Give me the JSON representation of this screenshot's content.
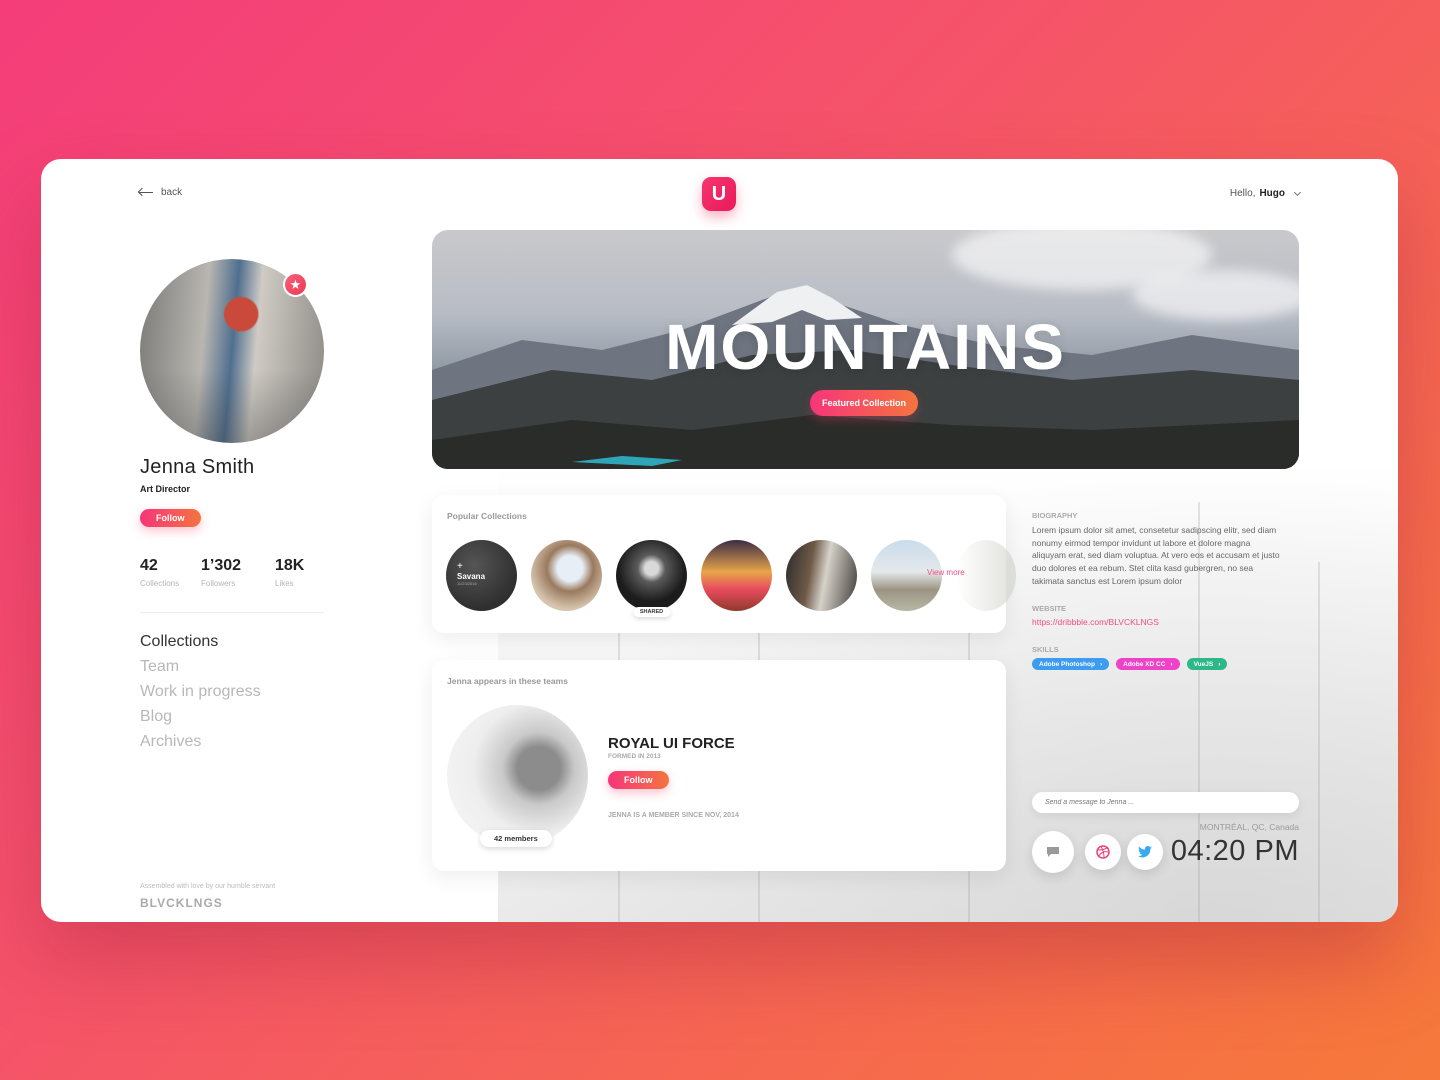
{
  "header": {
    "back_label": "back",
    "logo_text": "U",
    "greeting": "Hello,",
    "user": "Hugo"
  },
  "profile": {
    "name": "Jenna Smith",
    "role": "Art Director",
    "follow_label": "Follow",
    "stats": [
      {
        "value": "42",
        "label": "Collections"
      },
      {
        "value": "1’302",
        "label": "Followers"
      },
      {
        "value": "18K",
        "label": "Likes"
      }
    ]
  },
  "nav": {
    "items": [
      "Collections",
      "Team",
      "Work in progress",
      "Blog",
      "Archives"
    ]
  },
  "footer": {
    "note": "Assembled with love by our humble servant",
    "brand": "BLVCKLNGS"
  },
  "hero": {
    "title": "MOUNTAINS",
    "button_label": "Featured Collection"
  },
  "popular": {
    "title": "Popular Collections",
    "first": {
      "name": "Savana",
      "date": "11/23/2016"
    },
    "shared_label": "SHARED",
    "view_more": "View more"
  },
  "teams": {
    "title": "Jenna appears in these teams",
    "name": "ROYAL UI FORCE",
    "formed": "FORMED IN 2013",
    "follow_label": "Follow",
    "members": "42 members",
    "since": "JENNA IS A MEMBER SINCE NOV, 2014"
  },
  "bio": {
    "biography_label": "BIOGRAPHY",
    "biography": "Lorem ipsum dolor sit amet, consetetur sadipscing elitr, sed diam nonumy eirmod tempor invidunt ut labore et dolore magna aliquyam erat, sed diam voluptua. At vero eos et accusam et justo duo dolores et ea rebum. Stet clita kasd gubergren, no sea takimata sanctus est Lorem ipsum dolor",
    "website_label": "WEBSITE",
    "website": "https://dribbble.com/BLVCKLNGS",
    "skills_label": "SKILLS",
    "skills": [
      {
        "name": "Adobe Photoshop",
        "color": "#3d9cf0"
      },
      {
        "name": "Adobe XD CC",
        "color": "#ee42c8"
      },
      {
        "name": "VueJS",
        "color": "#2eb88a"
      }
    ]
  },
  "contact": {
    "message_placeholder": "Send a message to Jenna ...",
    "location": "MONTRÉAL, QC, Canada",
    "time": "04:20 PM",
    "icons": [
      "chat-icon",
      "dribbble-icon",
      "twitter-icon"
    ]
  },
  "colors": {
    "accent_start": "#f7357a",
    "accent_end": "#f4743f",
    "link": "#f04d86"
  }
}
